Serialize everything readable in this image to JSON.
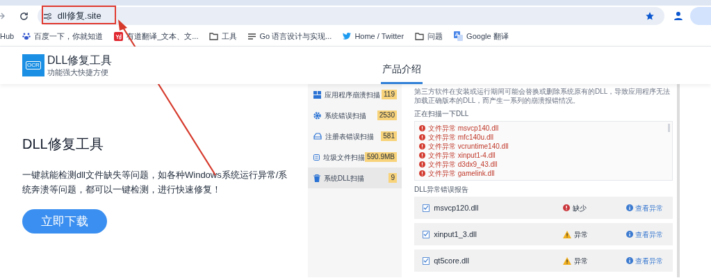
{
  "browser": {
    "address": "dll修复.site",
    "bookmarks": [
      {
        "label": "Hub",
        "kind": "text"
      },
      {
        "label": "百度一下，你就知道",
        "kind": "paw"
      },
      {
        "label": "有道翻译_文本、文...",
        "kind": "yd"
      },
      {
        "label": "工具",
        "kind": "folder"
      },
      {
        "label": "Go 语言设计与实现...",
        "kind": "lines"
      },
      {
        "label": "Home / Twitter",
        "kind": "bird"
      },
      {
        "label": "问题",
        "kind": "folder"
      },
      {
        "label": "Google 翻译",
        "kind": "translate"
      }
    ]
  },
  "site": {
    "logo_text": "OCR",
    "name": "DLL修复工具",
    "tagline": "功能强大快捷方便",
    "nav": [
      {
        "label": "产品介绍",
        "selected": true
      }
    ]
  },
  "hero": {
    "title": "DLL修复工具",
    "description": "一键就能检测dll文件缺失等问题，如各种Windows系统运行异常/系统奔溃等问题，都可以一键检测，进行快速修复！",
    "button": "立即下载"
  },
  "scanner": {
    "categories": [
      {
        "label": "应用程序崩溃扫描",
        "count": "119",
        "selected": false,
        "kind": "app"
      },
      {
        "label": "系统错误扫描",
        "count": "2530",
        "selected": false,
        "kind": "gear"
      },
      {
        "label": "注册表错误扫描",
        "count": "581",
        "selected": false,
        "kind": "registry"
      },
      {
        "label": "垃圾文件扫描",
        "count": "590.9MB",
        "selected": false,
        "kind": "files"
      },
      {
        "label": "系统DLL扫描",
        "count": "9",
        "selected": true,
        "kind": "trash"
      }
    ],
    "intro": "第三方软件在安装或运行期间可能会替换或删除系统原有的DLL，导致应用程序无法加载正确版本的DLL，而产生一系列的崩溃报错情况。",
    "scan_title": "正在扫描一下DLL",
    "scan_items": [
      "文件异常 msvcp140.dll",
      "文件异常 mfc140u.dll",
      "文件异常 vcruntime140.dll",
      "文件异常 xinput1-4.dll",
      "文件异常 d3dx9_43.dll",
      "文件异常 gamelink.dll"
    ],
    "report_title": "DLL异常错误报告",
    "report_rows": [
      {
        "file": "msvcp120.dll",
        "checked": true,
        "status": "缺少",
        "kind": "missing",
        "action": "查看异常"
      },
      {
        "file": "xinput1_3.dll",
        "checked": true,
        "status": "异常",
        "kind": "warning",
        "action": "查看异常"
      },
      {
        "file": "qt5core.dll",
        "checked": true,
        "status": "异常",
        "kind": "warning",
        "action": "查看异常"
      }
    ]
  }
}
